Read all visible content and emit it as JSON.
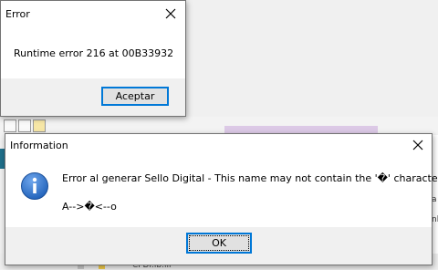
{
  "error_dialog": {
    "title": "Error",
    "message": "Runtime error 216 at 00B33932",
    "ok_label": "Aceptar"
  },
  "info_dialog": {
    "title": "Information",
    "message": "Error al generar Sello Digital - This name may not contain the '�' character:",
    "detail": "A-->�<--o",
    "ok_label": "OK",
    "icon": "information-icon"
  },
  "background": {
    "bottom_text": "CFDI.lb.lll",
    "right_text_1": "a",
    "right_text_2": "nb"
  },
  "colors": {
    "info_icon_blue": "#1d5fb8",
    "focus_border": "#0078d7",
    "footer_gray": "#f0f0f0"
  }
}
